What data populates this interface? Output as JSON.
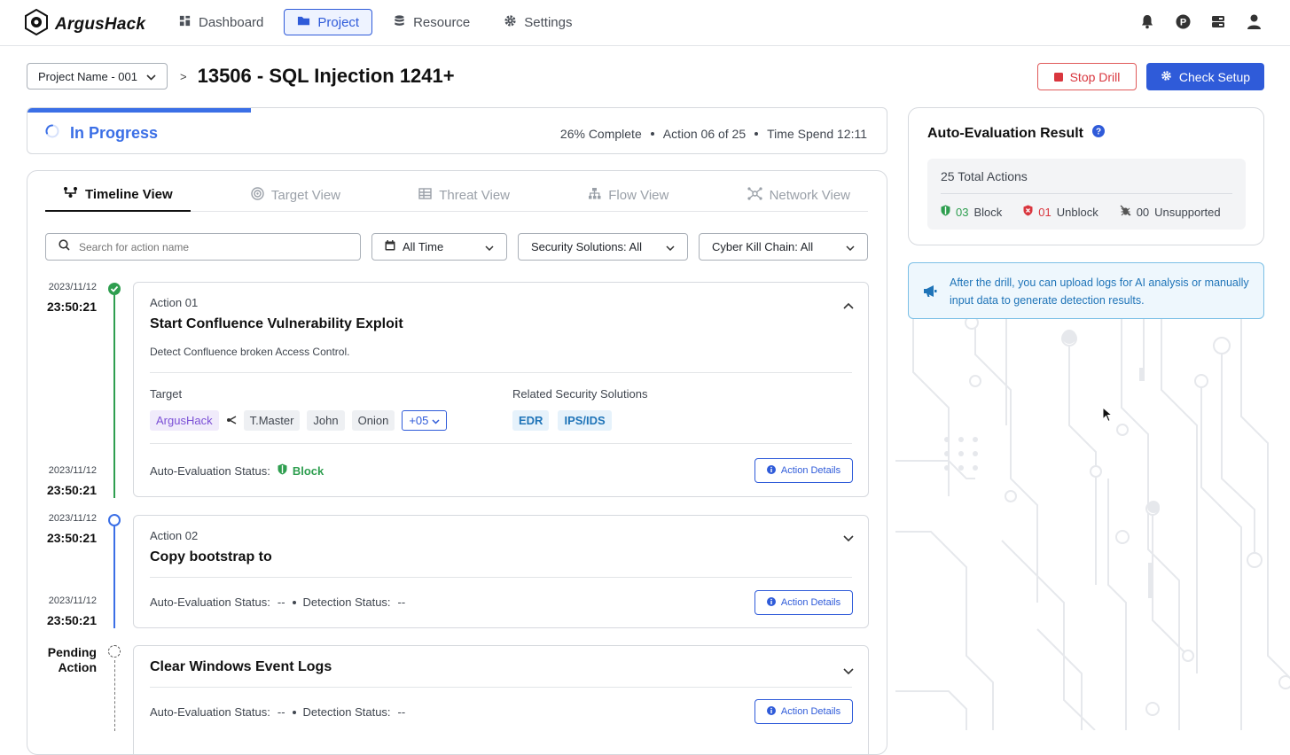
{
  "app": {
    "logo_text": "ArgusHack"
  },
  "nav": [
    {
      "label": "Dashboard",
      "icon": "grid-icon",
      "active": false
    },
    {
      "label": "Project",
      "icon": "folder-icon",
      "active": true
    },
    {
      "label": "Resource",
      "icon": "database-icon",
      "active": false
    },
    {
      "label": "Settings",
      "icon": "gear-icon",
      "active": false
    }
  ],
  "top_icons": [
    "bell-icon",
    "profile-p-icon",
    "storage-icon",
    "user-icon"
  ],
  "header": {
    "project_select": "Project Name - 001",
    "separator": ">",
    "title": "13506 - SQL Injection 1241+",
    "stop_label": "Stop Drill",
    "check_label": "Check Setup"
  },
  "progress": {
    "status": "In Progress",
    "percent": 26,
    "complete_text": "26% Complete",
    "action_text": "Action 06 of 25",
    "time_text": "Time Spend 12:11"
  },
  "tabs": [
    {
      "label": "Timeline View",
      "icon": "timeline-icon",
      "active": true
    },
    {
      "label": "Target View",
      "icon": "target-icon",
      "active": false
    },
    {
      "label": "Threat View",
      "icon": "table-icon",
      "active": false
    },
    {
      "label": "Flow View",
      "icon": "flow-icon",
      "active": false
    },
    {
      "label": "Network View",
      "icon": "network-icon",
      "active": false
    }
  ],
  "filters": {
    "search_placeholder": "Search for action name",
    "time": "All Time",
    "security": "Security Solutions: All",
    "killchain": "Cyber Kill Chain: All"
  },
  "timeline": {
    "entries": [
      {
        "date": "2023/11/12",
        "time": "23:50:21"
      },
      {
        "date": "2023/11/12",
        "time": "23:50:21"
      },
      {
        "date": "2023/11/12",
        "time": "23:50:21"
      },
      {
        "date": "2023/11/12",
        "time": "23:50:21"
      }
    ],
    "pending_line1": "Pending",
    "pending_line2": "Action"
  },
  "actions": [
    {
      "number": "Action 01",
      "title": "Start Confluence Vulnerability Exploit",
      "description": "Detect Confluence broken Access Control.",
      "target_label": "Target",
      "target_primary": "ArgusHack",
      "targets": [
        "T.Master",
        "John",
        "Onion"
      ],
      "more": "+05",
      "solutions_label": "Related Security Solutions",
      "solutions": [
        "EDR",
        "IPS/IDS"
      ],
      "eval_label": "Auto-Evaluation Status:",
      "eval_value": "Block",
      "details_label": "Action Details"
    },
    {
      "number": "Action 02",
      "title": "Copy bootstrap to",
      "eval_label": "Auto-Evaluation Status:",
      "eval_value": "--",
      "detect_label": "Detection Status:",
      "detect_value": "--",
      "details_label": "Action Details"
    },
    {
      "title": "Clear Windows Event Logs",
      "eval_label": "Auto-Evaluation Status:",
      "eval_value": "--",
      "detect_label": "Detection Status:",
      "detect_value": "--",
      "details_label": "Action Details"
    }
  ],
  "evaluation": {
    "title": "Auto-Evaluation Result",
    "total": "25 Total Actions",
    "block_count": "03",
    "block_label": "Block",
    "unblock_count": "01",
    "unblock_label": "Unblock",
    "unsupported_count": "00",
    "unsupported_label": "Unsupported"
  },
  "notice": {
    "text": "After the drill, you can upload logs for AI analysis or manually input data to generate detection results."
  },
  "colors": {
    "accent": "#2f5bd9",
    "progress": "#3b6fe6",
    "success": "#2e9e4f",
    "danger": "#d9363e",
    "info": "#1f74b8"
  }
}
